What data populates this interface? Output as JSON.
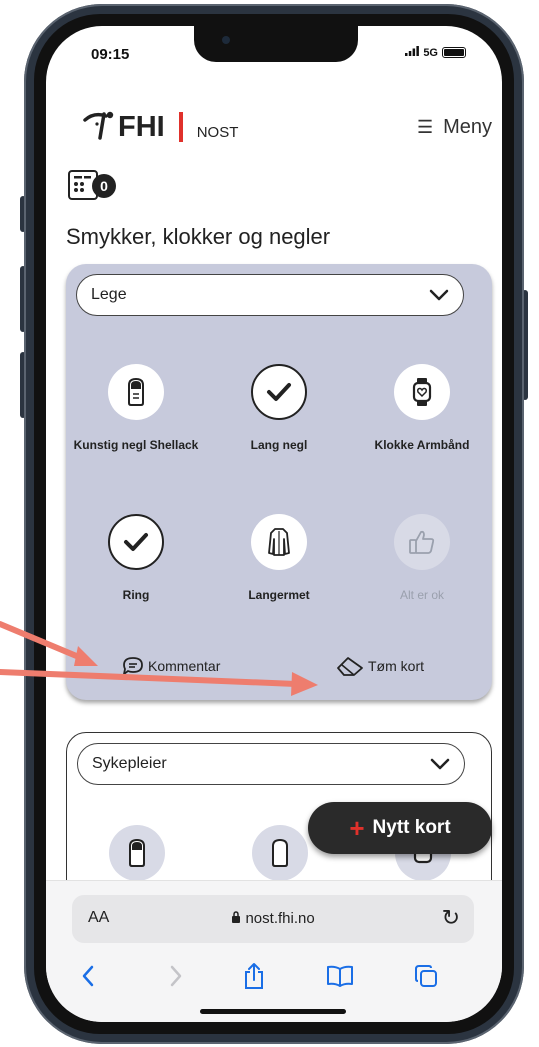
{
  "status_bar": {
    "time": "09:15",
    "network": "5G"
  },
  "header": {
    "brand": "FHI",
    "app_name": "NOST",
    "menu_label": "Meny",
    "counter_value": "0"
  },
  "section_title": "Smykker, klokker og negler",
  "card1": {
    "role": "Lege",
    "tiles": [
      {
        "label": "Kunstig negl Shellack",
        "icon": "nail-icon",
        "checked": false,
        "muted": false
      },
      {
        "label": "Lang negl",
        "icon": "check-icon",
        "checked": true,
        "muted": false
      },
      {
        "label": "Klokke Armbånd",
        "icon": "watch-icon",
        "checked": false,
        "muted": false
      },
      {
        "label": "Ring",
        "icon": "check-icon",
        "checked": true,
        "muted": false
      },
      {
        "label": "Langermet",
        "icon": "sleeve-icon",
        "checked": false,
        "muted": false
      },
      {
        "label": "Alt er ok",
        "icon": "thumbs-up-icon",
        "checked": false,
        "muted": true
      }
    ],
    "comment_label": "Kommentar",
    "clear_label": "Tøm kort"
  },
  "card2": {
    "role": "Sykepleier"
  },
  "fab": {
    "label": "Nytt kort"
  },
  "browser": {
    "aa_label": "AA",
    "url": "nost.fhi.no"
  },
  "colors": {
    "card_bg": "#c7cadc",
    "brand_red": "#e0312b",
    "arrow": "#ee7d6e",
    "fab_bg": "#2a2a2a"
  }
}
